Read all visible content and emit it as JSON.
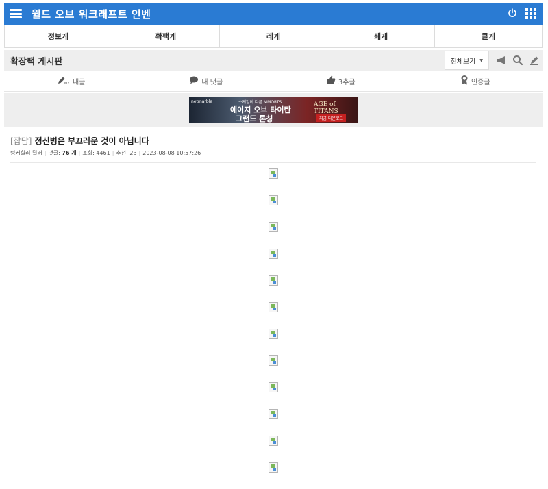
{
  "header": {
    "title": "월드 오브 워크래프트 인벤",
    "menu_icon": "hamburger-menu-icon",
    "power_icon": "power-icon",
    "apps_icon": "grid-apps-icon"
  },
  "tabs": [
    {
      "label": "정보게"
    },
    {
      "label": "확팩게"
    },
    {
      "label": "레게"
    },
    {
      "label": "쐐게"
    },
    {
      "label": "클게"
    }
  ],
  "board": {
    "title": "확장팩 게시판",
    "view_select": "전체보기",
    "icons": [
      "megaphone-icon",
      "search-icon",
      "pencil-icon"
    ]
  },
  "subnav": [
    {
      "label": "내글",
      "icon": "my-post-icon"
    },
    {
      "label": "내 댓글",
      "icon": "comment-bubble-icon"
    },
    {
      "label": "3추글",
      "icon": "thumbs-up-icon"
    },
    {
      "label": "인증글",
      "icon": "medal-icon"
    }
  ],
  "ad": {
    "brand": "netmarble",
    "sub": "스케일이 다른 MMORTS",
    "line1": "에이지 오브 타이탄",
    "line2": "그랜드 론칭",
    "game": "AGE of TITANS",
    "cta": "지금 다운로드"
  },
  "post": {
    "category": "[잡담]",
    "title": "정신병은 부끄러운 것이 아닙니다",
    "author": "텅커힐러 딜러",
    "comments_label": "댓글:",
    "comments_count": "76 개",
    "views": "조회: 4461",
    "recommends": "추천: 23",
    "datetime": "2023-08-08 10:57:26"
  },
  "images": [
    "broken-image",
    "broken-image",
    "broken-image",
    "broken-image",
    "broken-image",
    "broken-image",
    "broken-image",
    "broken-image",
    "broken-image",
    "broken-image",
    "broken-image",
    "broken-image"
  ],
  "colors": {
    "header_bg": "#2a7bd3",
    "bar_bg": "#eeeeee"
  }
}
